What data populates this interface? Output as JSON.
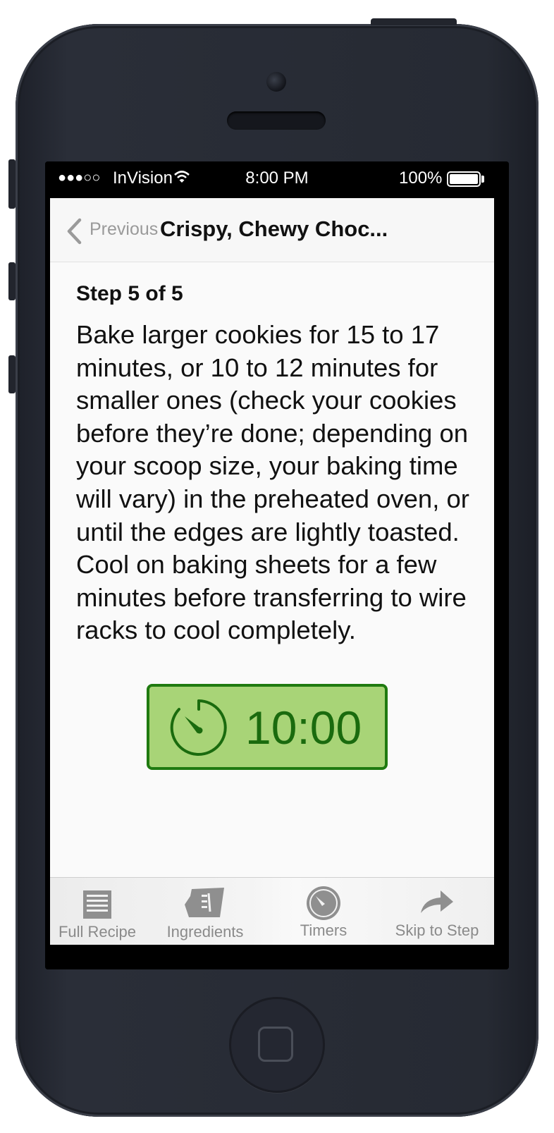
{
  "status_bar": {
    "signal": "●●●○○",
    "carrier": "InVision",
    "time": "8:00 PM",
    "battery": "100%"
  },
  "nav": {
    "back_label": "Previous",
    "title": "Crispy, Chewy Choc..."
  },
  "step": {
    "label": "Step 5 of 5",
    "text": "Bake larger cookies for 15 to 17 minutes, or 10 to 12 minutes for smaller ones (check your cookies before they’re done; depending on your scoop size, your baking time will vary) in the preheated oven, or until the edges are lightly toasted. Cool on baking sheets for a few minutes before transferring to wire racks to cool completely."
  },
  "timer": {
    "value": "10:00",
    "icon": "stopwatch-icon",
    "background": "#a8d477",
    "accent": "#1f7a10"
  },
  "tabs": [
    {
      "label": "Full Recipe",
      "icon": "document-icon"
    },
    {
      "label": "Ingredients",
      "icon": "measuring-cup-icon"
    },
    {
      "label": "Timers",
      "icon": "stopwatch-icon"
    },
    {
      "label": "Skip to Step",
      "icon": "forward-arrow-icon"
    }
  ]
}
